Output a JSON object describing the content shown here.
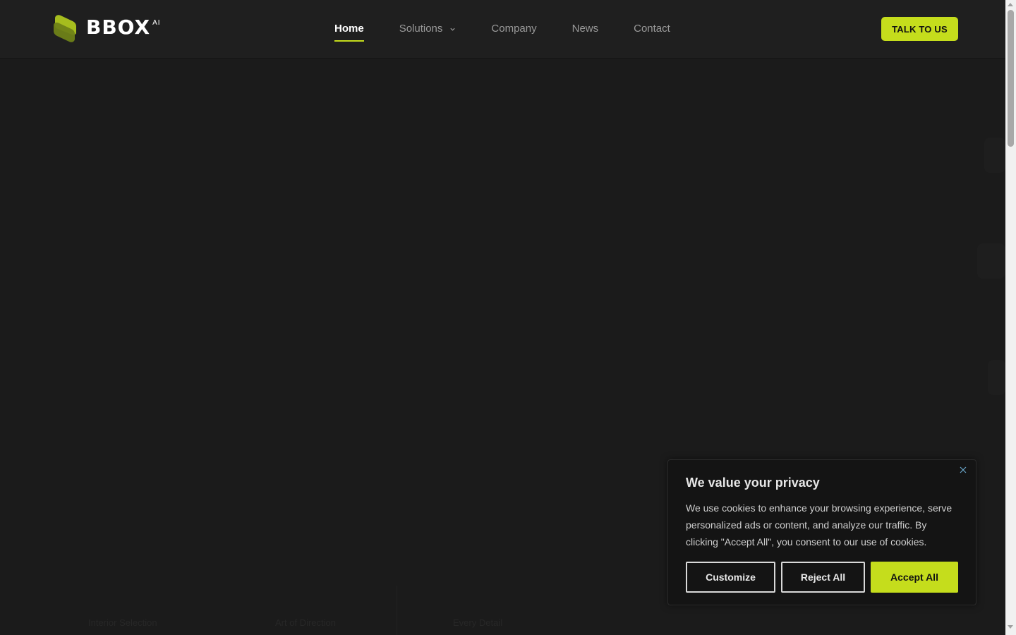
{
  "brand": {
    "name": "BBOX",
    "superscript": "AI",
    "accent_color": "#c5dd1c"
  },
  "nav": {
    "items": [
      {
        "label": "Home",
        "active": true
      },
      {
        "label": "Solutions",
        "has_dropdown": true,
        "icon": "chevron-down-icon"
      },
      {
        "label": "Company"
      },
      {
        "label": "News"
      },
      {
        "label": "Contact"
      }
    ],
    "cta_label": "TALK TO US"
  },
  "background_labels": [
    "Interior Selection",
    "Art of Direction",
    "Every Detail"
  ],
  "cookie_banner": {
    "title": "We value your privacy",
    "body": "We use cookies to enhance your browsing experience, serve personalized ads or content, and analyze our traffic. By clicking \"Accept All\", you consent to our use of cookies.",
    "close_icon": "close-icon",
    "buttons": {
      "customize": "Customize",
      "reject": "Reject All",
      "accept": "Accept All"
    }
  }
}
